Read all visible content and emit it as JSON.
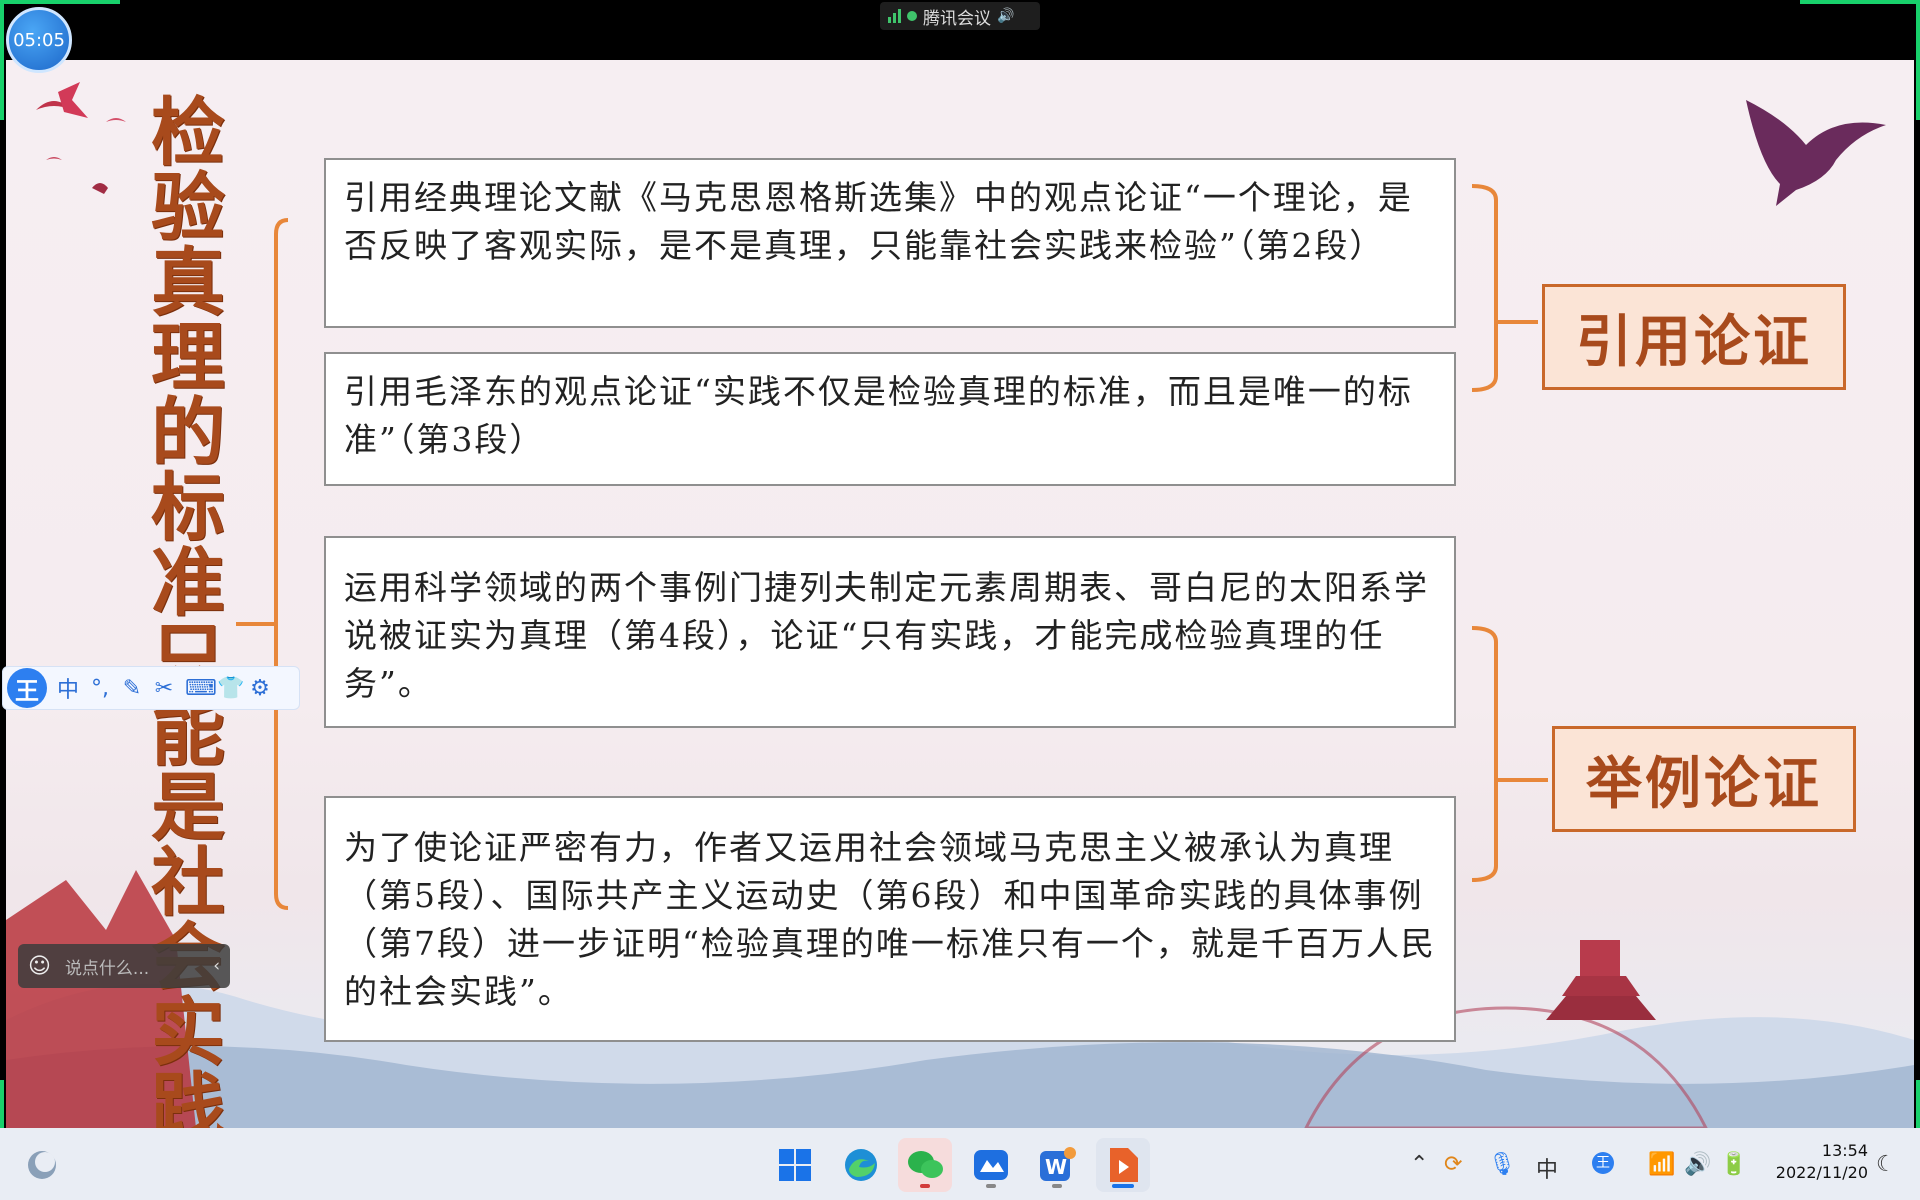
{
  "meeting": {
    "timer": "05:05",
    "app_name": "腾讯会议"
  },
  "slide": {
    "vertical_title": "检验真理的标准只能是社会实践",
    "boxes": [
      "引用经典理论文献《马克思恩格斯选集》中的观点论证“一个理论，是否反映了客观实际，是不是真理，只能靠社会实践来检验”（第2段）",
      "引用毛泽东的观点论证“实践不仅是检验真理的标准，而且是唯一的标准”（第3段）",
      "运用科学领域的两个事例门捷列夫制定元素周期表、哥白尼的太阳系学说被证实为真理（第4段），论证“只有实践，才能完成检验真理的任务”。",
      "为了使论证严密有力，作者又运用社会领域马克思主义被承认为真理（第5段）、国际共产主义运动史（第6段）和中国革命实践的具体事例（第7段）进一步证明“检验真理的唯一标准只有一个，就是千百万人民的社会实践”。"
    ],
    "labels": {
      "citation": "引用论证",
      "example": "举例论证"
    },
    "colors": {
      "accent": "#c9682a",
      "title": "#a84a1c",
      "label_bg": "#fbe4d6"
    }
  },
  "ime_toolbar": {
    "logo": "王",
    "mode": "中"
  },
  "chat": {
    "placeholder": "说点什么..."
  },
  "taskbar": {
    "apps": [
      "windows-start",
      "edge-browser",
      "wechat",
      "tencent-meeting",
      "wps-writer",
      "wps-presentation"
    ],
    "tray": {
      "ime_mode": "中",
      "ime_logo": "王"
    },
    "time": "13:54",
    "date": "2022/11/20"
  }
}
